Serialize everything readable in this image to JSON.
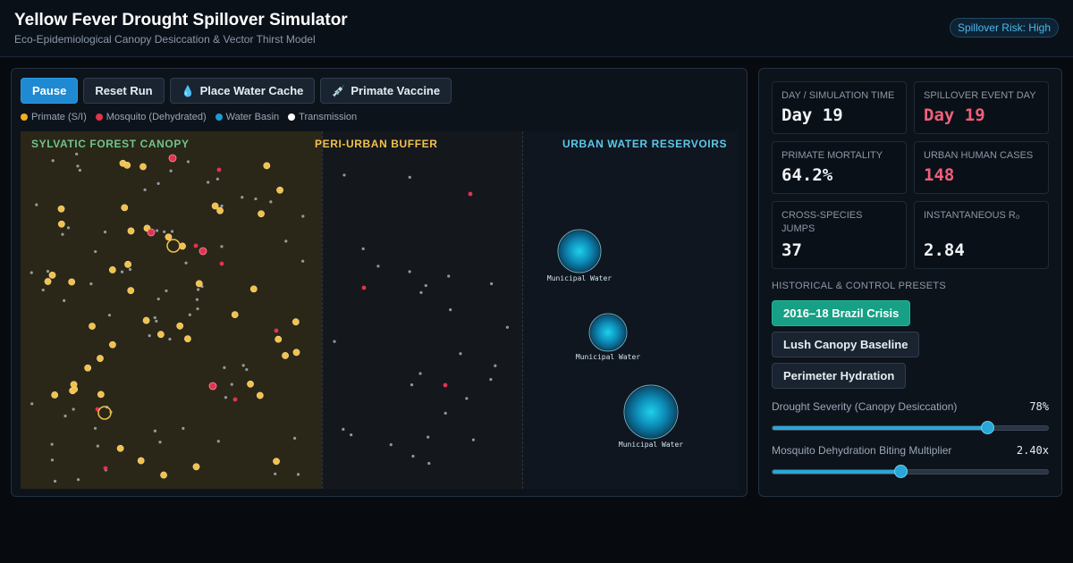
{
  "header": {
    "title": "Yellow Fever Drought Spillover Simulator",
    "subtitle": "Eco-Epidemiological Canopy Desiccation & Vector Thirst Model",
    "risk_badge": "Spillover Risk: High"
  },
  "toolbar": {
    "pause_label": "Pause",
    "reset_label": "Reset Run",
    "water_cache_label": "Place Water Cache",
    "vaccine_label": "Primate Vaccine"
  },
  "legend": {
    "primate": "Primate (S/I)",
    "mosquito": "Mosquito (Dehydrated)",
    "water": "Water Basin",
    "transmission": "Transmission"
  },
  "zones": {
    "forest": "SYLVATIC FOREST CANOPY",
    "buffer": "PERI-URBAN BUFFER",
    "urban": "URBAN WATER RESERVOIRS"
  },
  "basins": [
    "Municipal Water",
    "Municipal Water",
    "Municipal Water"
  ],
  "stats": {
    "day_label": "DAY / SIMULATION TIME",
    "day_value": "Day 19",
    "spill_label": "SPILLOVER EVENT DAY",
    "spill_value": "Day 19",
    "mortality_label": "PRIMATE MORTALITY",
    "mortality_value": "64.2%",
    "urban_label": "URBAN HUMAN CASES",
    "urban_value": "148",
    "jumps_label": "CROSS-SPECIES JUMPS",
    "jumps_value": "37",
    "r0_label": "INSTANTANEOUS R₀",
    "r0_value": "2.84"
  },
  "presets": {
    "section_label": "HISTORICAL & CONTROL PRESETS",
    "items": [
      "2016–18 Brazil Crisis",
      "Lush Canopy Baseline",
      "Perimeter Hydration"
    ]
  },
  "sliders": {
    "drought": {
      "label": "Drought Severity (Canopy Desiccation)",
      "value_text": "78%",
      "fraction": 0.78
    },
    "biting": {
      "label": "Mosquito Dehydration Biting Multiplier",
      "value_text": "2.40x",
      "fraction": 0.465
    }
  },
  "colors": {
    "primate": "#f2c14e",
    "mosquito": "#e0344f",
    "water": "#1e9bd7",
    "transmission": "#ffffff",
    "accent": "#1f8ad2",
    "preset_active": "#17a085"
  }
}
